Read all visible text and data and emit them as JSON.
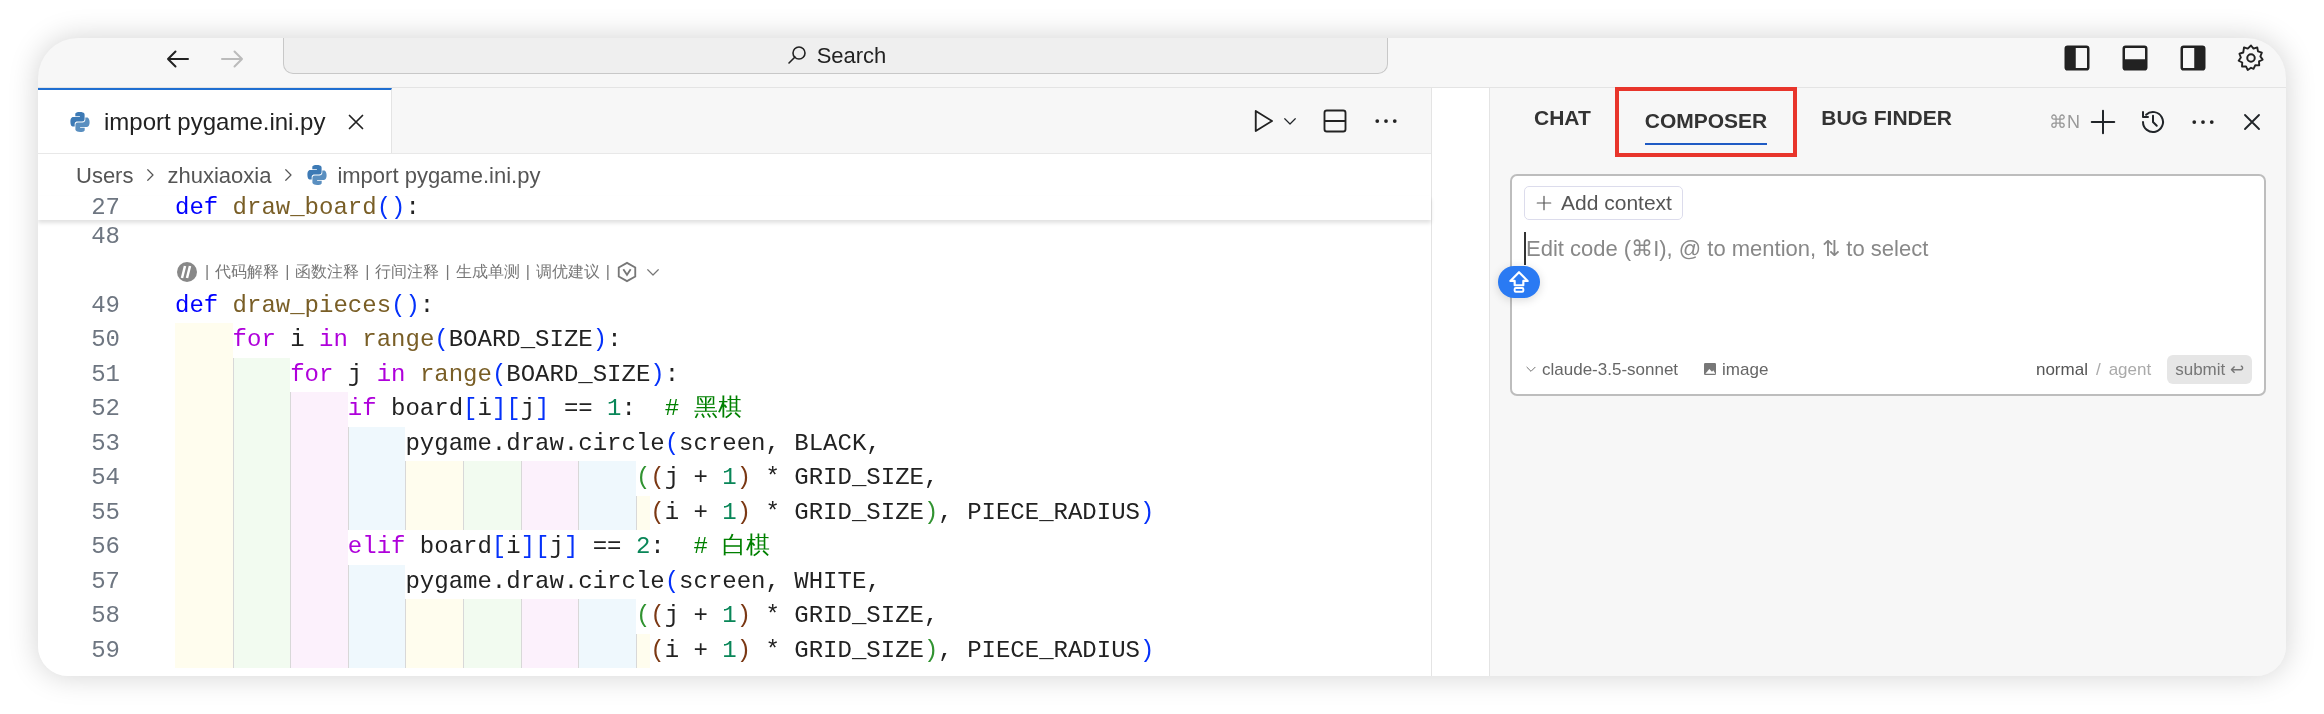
{
  "titlebar": {
    "back": {
      "disabled": false
    },
    "forward": {
      "disabled": true
    },
    "search": {
      "placeholder": "Search"
    }
  },
  "editor": {
    "tabs": [
      {
        "label": "import pygame.ini.py",
        "selected": true
      }
    ],
    "breadcrumbs": [
      {
        "label": "Users",
        "kind": "folder"
      },
      {
        "label": "zhuxiaoxia",
        "kind": "folder"
      },
      {
        "label": "import pygame.ini.py",
        "kind": "python"
      }
    ],
    "sticky_line": {
      "number": "27",
      "tokens": [
        {
          "text": "def ",
          "kind": "keyword"
        },
        {
          "text": "draw_board",
          "kind": "function"
        },
        {
          "text": "()",
          "kind": "bracket1"
        },
        {
          "text": ":",
          "kind": "plain"
        }
      ]
    },
    "lines": [
      {
        "number": "48"
      },
      {
        "kind": "codelens",
        "separator": "|",
        "items": [
          "代码解释",
          "函数注释",
          "行间注释",
          "生成单测",
          "调优建议"
        ]
      },
      {
        "number": "49",
        "tokens": [
          {
            "text": "def ",
            "kind": "keyword"
          },
          {
            "text": "draw_pieces",
            "kind": "function"
          },
          {
            "text": "()",
            "kind": "bracket1"
          },
          {
            "text": ":",
            "kind": "plain"
          }
        ]
      },
      {
        "number": "50",
        "tokens": [
          {
            "text": "    for",
            "kind": "control"
          },
          {
            "text": " i ",
            "kind": "plain"
          },
          {
            "text": "in ",
            "kind": "control"
          },
          {
            "text": "range",
            "kind": "function"
          },
          {
            "text": "(",
            "kind": "bracket1"
          },
          {
            "text": "BOARD_SIZE",
            "kind": "plain"
          },
          {
            "text": ")",
            "kind": "bracket1"
          },
          {
            "text": ":",
            "kind": "plain"
          }
        ]
      },
      {
        "number": "51",
        "tokens": [
          {
            "text": "        for",
            "kind": "control"
          },
          {
            "text": " j ",
            "kind": "plain"
          },
          {
            "text": "in ",
            "kind": "control"
          },
          {
            "text": "range",
            "kind": "function"
          },
          {
            "text": "(",
            "kind": "bracket1"
          },
          {
            "text": "BOARD_SIZE",
            "kind": "plain"
          },
          {
            "text": ")",
            "kind": "bracket1"
          },
          {
            "text": ":",
            "kind": "plain"
          }
        ]
      },
      {
        "number": "52",
        "tokens": [
          {
            "text": "            if",
            "kind": "control"
          },
          {
            "text": " board",
            "kind": "plain"
          },
          {
            "text": "[",
            "kind": "bracket1"
          },
          {
            "text": "i",
            "kind": "plain"
          },
          {
            "text": "][",
            "kind": "bracket1"
          },
          {
            "text": "j",
            "kind": "plain"
          },
          {
            "text": "]",
            "kind": "bracket1"
          },
          {
            "text": " == ",
            "kind": "plain"
          },
          {
            "text": "1",
            "kind": "number"
          },
          {
            "text": ":  ",
            "kind": "plain"
          },
          {
            "text": "# 黑棋",
            "kind": "comment"
          }
        ]
      },
      {
        "number": "53",
        "tokens": [
          {
            "text": "                pygame.draw.circle",
            "kind": "plain"
          },
          {
            "text": "(",
            "kind": "bracket1"
          },
          {
            "text": "screen, BLACK,",
            "kind": "plain"
          }
        ]
      },
      {
        "number": "54",
        "tokens": [
          {
            "text": "                                (",
            "kind": "bracket2"
          },
          {
            "text": "(",
            "kind": "bracket3"
          },
          {
            "text": "j + ",
            "kind": "plain"
          },
          {
            "text": "1",
            "kind": "number"
          },
          {
            "text": ")",
            "kind": "bracket3"
          },
          {
            "text": " * GRID_SIZE,",
            "kind": "plain"
          }
        ]
      },
      {
        "number": "55",
        "tokens": [
          {
            "text": "                                 (",
            "kind": "bracket3"
          },
          {
            "text": "i + ",
            "kind": "plain"
          },
          {
            "text": "1",
            "kind": "number"
          },
          {
            "text": ")",
            "kind": "bracket3"
          },
          {
            "text": " * GRID_SIZE",
            "kind": "plain"
          },
          {
            "text": ")",
            "kind": "bracket2"
          },
          {
            "text": ", PIECE_RADIUS",
            "kind": "plain"
          },
          {
            "text": ")",
            "kind": "bracket1"
          }
        ]
      },
      {
        "number": "56",
        "tokens": [
          {
            "text": "            elif",
            "kind": "control"
          },
          {
            "text": " board",
            "kind": "plain"
          },
          {
            "text": "[",
            "kind": "bracket1"
          },
          {
            "text": "i",
            "kind": "plain"
          },
          {
            "text": "][",
            "kind": "bracket1"
          },
          {
            "text": "j",
            "kind": "plain"
          },
          {
            "text": "]",
            "kind": "bracket1"
          },
          {
            "text": " == ",
            "kind": "plain"
          },
          {
            "text": "2",
            "kind": "number"
          },
          {
            "text": ":  ",
            "kind": "plain"
          },
          {
            "text": "# 白棋",
            "kind": "comment"
          }
        ]
      },
      {
        "number": "57",
        "tokens": [
          {
            "text": "                pygame.draw.circle",
            "kind": "plain"
          },
          {
            "text": "(",
            "kind": "bracket1"
          },
          {
            "text": "screen, WHITE,",
            "kind": "plain"
          }
        ]
      },
      {
        "number": "58",
        "tokens": [
          {
            "text": "                                (",
            "kind": "bracket2"
          },
          {
            "text": "(",
            "kind": "bracket3"
          },
          {
            "text": "j + ",
            "kind": "plain"
          },
          {
            "text": "1",
            "kind": "number"
          },
          {
            "text": ")",
            "kind": "bracket3"
          },
          {
            "text": " * GRID_SIZE,",
            "kind": "plain"
          }
        ]
      },
      {
        "number": "59",
        "tokens": [
          {
            "text": "                                 (",
            "kind": "bracket3"
          },
          {
            "text": "i + ",
            "kind": "plain"
          },
          {
            "text": "1",
            "kind": "number"
          },
          {
            "text": ")",
            "kind": "bracket3"
          },
          {
            "text": " * GRID_SIZE",
            "kind": "plain"
          },
          {
            "text": ")",
            "kind": "bracket2"
          },
          {
            "text": ", PIECE_RADIUS",
            "kind": "plain"
          },
          {
            "text": ")",
            "kind": "bracket1"
          }
        ]
      }
    ]
  },
  "panel": {
    "tabs": [
      {
        "label": "CHAT",
        "selected": false,
        "highlighted": false
      },
      {
        "label": "COMPOSER",
        "selected": true,
        "highlighted": true
      },
      {
        "label": "BUG FINDER",
        "selected": false,
        "highlighted": false
      }
    ],
    "shortcut": "⌘N",
    "composer": {
      "add_context": "Add context",
      "placeholder": "Edit code (⌘I), @ to mention, ⇅ to select",
      "model": "claude-3.5-sonnet",
      "image": "image",
      "modes": [
        {
          "label": "normal",
          "selected": true
        },
        {
          "label": "agent",
          "selected": false
        }
      ],
      "mode_separator": "/",
      "submit": "submit",
      "submit_key": "↩"
    }
  }
}
